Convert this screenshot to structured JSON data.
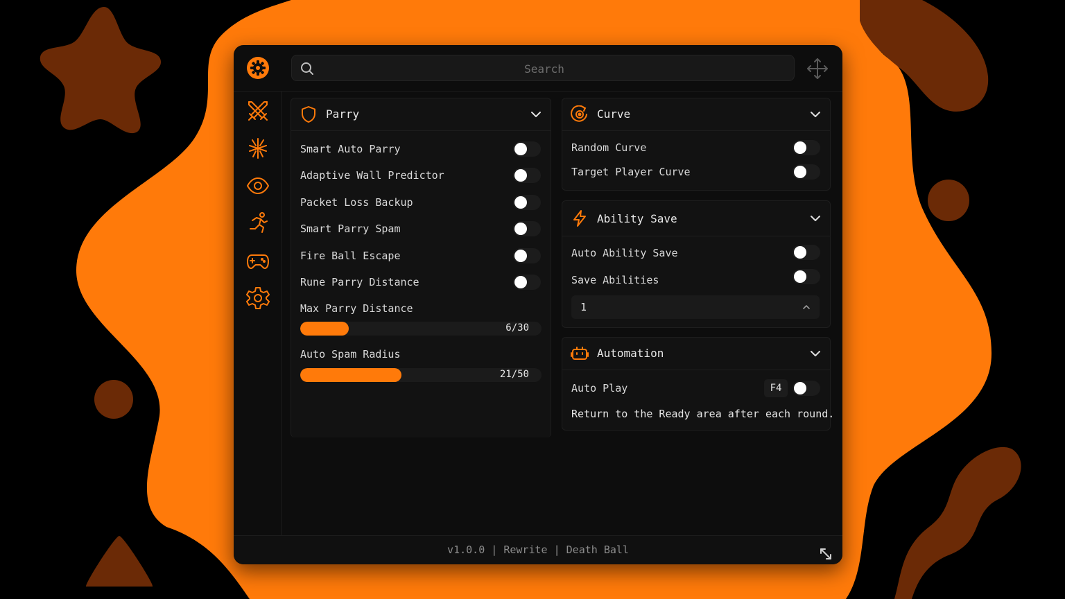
{
  "colors": {
    "accent": "#ff7a0a",
    "accent_dark": "#6b2a06",
    "panel": "#0d0d0d",
    "card": "#121212"
  },
  "search": {
    "placeholder": "Search"
  },
  "sidebar": {
    "items": [
      {
        "icon": "crossed-swords-icon"
      },
      {
        "icon": "sparkle-icon"
      },
      {
        "icon": "eye-icon"
      },
      {
        "icon": "running-person-icon"
      },
      {
        "icon": "gamepad-icon"
      },
      {
        "icon": "gear-icon"
      }
    ]
  },
  "parry": {
    "title": "Parry",
    "toggles": [
      {
        "label": "Smart Auto Parry",
        "on": false
      },
      {
        "label": "Adaptive Wall Predictor",
        "on": false
      },
      {
        "label": "Packet Loss Backup",
        "on": false
      },
      {
        "label": "Smart Parry Spam",
        "on": false
      },
      {
        "label": "Fire Ball Escape",
        "on": false
      },
      {
        "label": "Rune Parry Distance",
        "on": false
      }
    ],
    "sliders": [
      {
        "label": "Max Parry Distance",
        "value": 6,
        "max": 30,
        "display": "6/30"
      },
      {
        "label": "Auto Spam Radius",
        "value": 21,
        "max": 50,
        "display": "21/50"
      }
    ]
  },
  "curve": {
    "title": "Curve",
    "toggles": [
      {
        "label": "Random Curve",
        "on": false
      },
      {
        "label": "Target Player Curve",
        "on": false
      }
    ]
  },
  "ability_save": {
    "title": "Ability Save",
    "toggles": [
      {
        "label": "Auto Ability Save",
        "on": false
      },
      {
        "label": "Save Abilities",
        "on": false
      }
    ],
    "select_value": "1"
  },
  "automation": {
    "title": "Automation",
    "auto_play": {
      "label": "Auto Play",
      "key": "F4",
      "on": false
    },
    "description": "Return to the Ready area after each round."
  },
  "footer": {
    "text": "v1.0.0 | Rewrite | Death Ball"
  }
}
